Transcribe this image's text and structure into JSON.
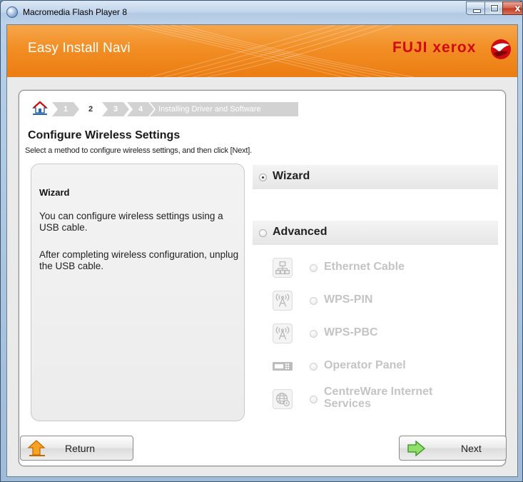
{
  "window": {
    "title": "Macromedia Flash Player 8",
    "close_glyph": "x"
  },
  "banner": {
    "app_title": "Easy Install Navi",
    "brand": "FUJI xerox"
  },
  "breadcrumb": {
    "steps": [
      "1",
      "2",
      "3",
      "4"
    ],
    "current_step": "2",
    "final_step": "Installing Driver and Software"
  },
  "page": {
    "title": "Configure Wireless Settings",
    "subtitle": "Select a method to configure wireless settings, and then click [Next]."
  },
  "description": {
    "title": "Wizard",
    "paragraph1": "You can configure wireless settings using a USB cable.",
    "paragraph2": "After completing wireless configuration, unplug the USB cable."
  },
  "options": {
    "wizard": {
      "label": "Wizard",
      "selected": true
    },
    "advanced": {
      "label": "Advanced",
      "selected": false
    },
    "sub_options": [
      {
        "label": "Ethernet Cable",
        "icon": "network-icon",
        "enabled": false
      },
      {
        "label": "WPS-PIN",
        "icon": "wireless-antenna-icon",
        "enabled": false
      },
      {
        "label": "WPS-PBC",
        "icon": "wireless-antenna-icon",
        "enabled": false
      },
      {
        "label": "Operator Panel",
        "icon": "operator-panel-icon",
        "enabled": false
      },
      {
        "label": "CentreWare Internet\nServices",
        "icon": "globe-gear-icon",
        "enabled": false
      }
    ]
  },
  "buttons": {
    "return": "Return",
    "next": "Next"
  },
  "colors": {
    "banner_orange": "#f28e24",
    "brand_red": "#d10a11",
    "disabled_text": "#c4c4c4"
  }
}
